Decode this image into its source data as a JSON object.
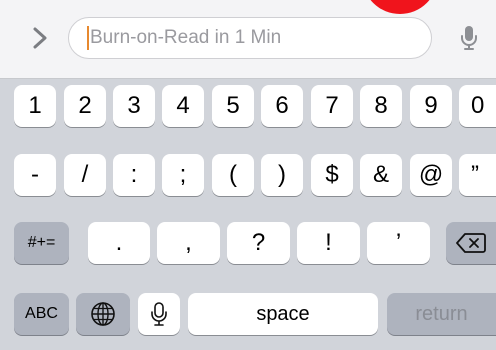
{
  "search_bar": {
    "placeholder": "Burn-on-Read in 1 Min"
  },
  "keyboard": {
    "row1": [
      "1",
      "2",
      "3",
      "4",
      "5",
      "6",
      "7",
      "8",
      "9",
      "0"
    ],
    "row2": [
      "-",
      "/",
      ":",
      ";",
      "(",
      ")",
      "$",
      "&",
      "@",
      "”"
    ],
    "row3": {
      "symbols_label": "#+=",
      "keys": [
        ".",
        ",",
        "?",
        "!",
        "’"
      ]
    },
    "row4": {
      "abc_label": "ABC",
      "space_label": "space",
      "return_label": "return"
    }
  },
  "colors": {
    "accent_caret": "#e7892f",
    "keyboard_bg": "#d1d4da",
    "dark_key": "#aeb3be",
    "red_button": "#f0141c"
  },
  "icons": [
    "chevron-right-icon",
    "microphone-icon",
    "globe-icon",
    "delete-icon"
  ]
}
